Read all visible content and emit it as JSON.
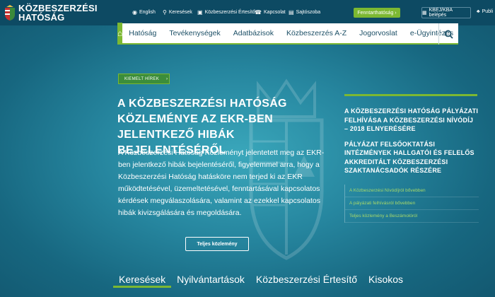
{
  "brand": {
    "line1": "KÖZBESZERZÉSI",
    "line2": "HATÓSÁG",
    "logo_icon": "coat-of-arms-icon"
  },
  "utility": {
    "english": "English",
    "searches": "Keresések",
    "bulletin": "Közbeszerzési Értesítő",
    "contact": "Kapcsolat",
    "press": "Sajtószoba",
    "maintenance": "Fenntarthatóság ›",
    "login": "KBEJ/KBA belépés",
    "publi": "Publi"
  },
  "nav": {
    "items": [
      "Hatóság",
      "Tevékenységek",
      "Adatbázisok",
      "Közbeszerzés A-Z",
      "Jogorvoslat",
      "e-Ügyintézés"
    ]
  },
  "featured": {
    "tag": "KIEMELT HÍREK",
    "headline": "A KÖZBESZERZÉSI HATÓSÁG KÖZLEMÉNYE AZ EKR-BEN JELENTKEZŐ HIBÁK BEJELENTÉSÉRŐL",
    "body": "A Közbeszerzési Hatóság Közleményt jelentetett meg az EKR-ben jelentkező hibák bejelentéséről, figyelemmel arra, hogy a Közbeszerzési Hatóság hatásköre nem terjed ki az EKR működtetésével, üzemeltetésével, fenntartásával kapcsolatos kérdések megválaszolására, valamint az ezekkel kapcsolatos hibák kivizsgálására és megoldására.",
    "button": "Teljes közlemény"
  },
  "side": {
    "titles": [
      "A KÖZBESZERZÉSI HATÓSÁG PÁLYÁZATI FELHÍVÁSA A KÖZBESZERZÉSI NÍVÓDÍJ – 2018 ELNYERÉSÉRE",
      "PÁLYÁZAT FELSŐOKTATÁSI INTÉZMÉNYEK HALLGATÓI ÉS FELELŐS AKKREDITÁLT KÖZBESZERZÉSI SZAKTANÁCSADÓK RÉSZÉRE"
    ],
    "links": [
      "A Közbeszerzési Nívódíjról bővebben",
      "A pályázati felhívásról bővebben",
      "Teljes közlemény a Beszámolóról"
    ]
  },
  "tabs": [
    "Keresések",
    "Nyilvántartások",
    "Közbeszerzési Értesítő",
    "Kisokos"
  ],
  "colors": {
    "accent": "#7cb832",
    "topbar": "#0d4a63",
    "hero": "#26869f",
    "nav_text": "#1c4f66"
  }
}
